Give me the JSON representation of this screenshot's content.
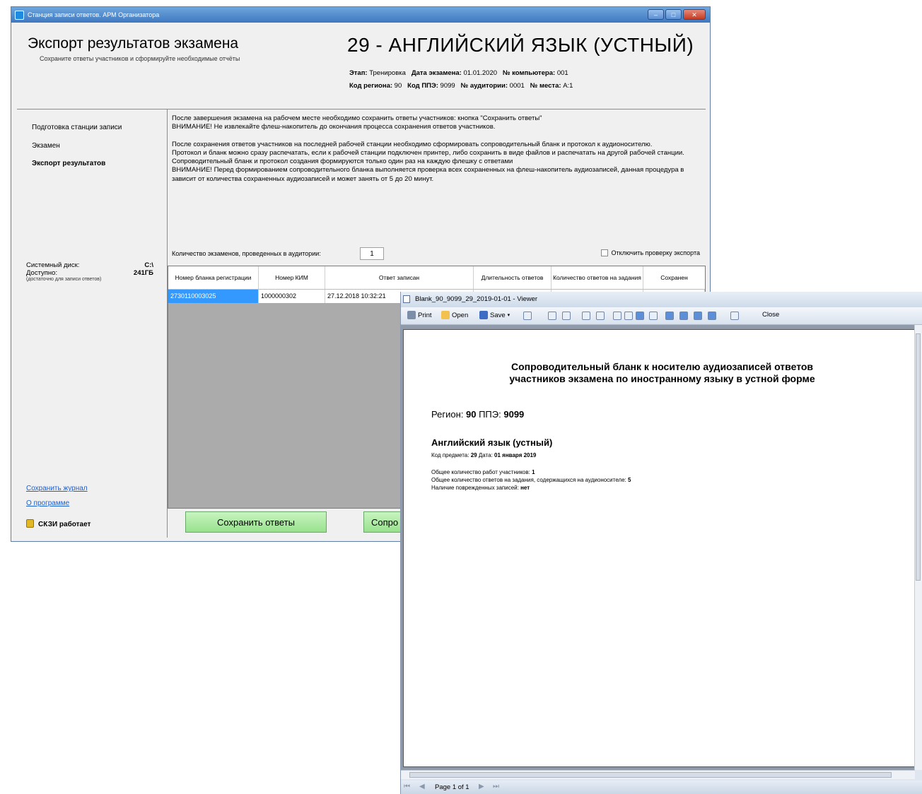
{
  "main_window": {
    "title": "Станция записи ответов. АРМ Организатора",
    "page_title": "Экспорт результатов экзамена",
    "page_subtitle": "Сохраните ответы участников и сформируйте необходимые отчёты",
    "subject_title": "29 - АНГЛИЙСКИЙ ЯЗЫК (УСТНЫЙ)",
    "info": {
      "stage_label": "Этап:",
      "stage_value": "Тренировка",
      "date_label": "Дата экзамена:",
      "date_value": "01.01.2020",
      "pc_label": "№ компьютера:",
      "pc_value": "001",
      "region_label": "Код региона:",
      "region_value": "90",
      "ppe_label": "Код ППЭ:",
      "ppe_value": "9099",
      "room_label": "№ аудитории:",
      "room_value": "0001",
      "seat_label": "№ места:",
      "seat_value": "А:1"
    },
    "nav": {
      "prep": "Подготовка станции записи",
      "exam": "Экзамен",
      "export": "Экспорт результатов"
    },
    "disk": {
      "system_label": "Системный диск:",
      "system_value": "C:\\",
      "free_label": "Доступно:",
      "free_value": "241ГБ",
      "note": "(достаточно для записи ответов)"
    },
    "links": {
      "save_log": "Сохранить журнал",
      "about": "О программе"
    },
    "skzi_status": "СКЗИ работает",
    "instructions": [
      "После завершения экзамена на рабочем месте необходимо сохранить ответы участников: кнопка \"Сохранить ответы\"\nВНИМАНИЕ! Не извлекайте флеш-накопитель до окончания процесса сохранения ответов участников.",
      "После сохранения ответов участников на последней рабочей станции необходимо сформировать сопроводительный бланк и протокол к аудионосителю.\nПротокол и бланк можно сразу распечатать, если к рабочей станции подключен принтер, либо сохранить в виде файлов и распечатать на другой рабочей станции. Сопроводительный бланк и протокол создания формируются только один раз на каждую флешку с ответами\nВНИМАНИЕ! Перед формированием сопроводительного бланка выполняется проверка всех сохраненных на флеш-накопитель аудиозаписей, данная процедура в зависит от количества сохраненных аудиозаписей и может занять от 5 до 20 минут."
    ],
    "count_label": "Количество экзаменов, проведенных в аудитории:",
    "count_value": "1",
    "disable_check_label": "Отключить проверку экспорта",
    "table": {
      "headers": [
        "Номер бланка регистрации",
        "Номер КИМ",
        "Ответ записан",
        "Длительность ответов",
        "Количество ответов на задания",
        "Сохранен"
      ],
      "row": [
        "2730110003025",
        "1000000302",
        "27.12.2018 10:32:21",
        "",
        "",
        ""
      ]
    },
    "buttons": {
      "save_answers": "Сохранить ответы",
      "accompany": "Сопро"
    }
  },
  "viewer": {
    "title": "Blank_90_9099_29_2019-01-01 - Viewer",
    "toolbar": {
      "print": "Print",
      "open": "Open",
      "save": "Save",
      "close": "Close"
    },
    "page_indicator": "Page 1 of 1",
    "document": {
      "title_line1": "Сопроводительный бланк к носителю аудиозаписей ответов",
      "title_line2": "участников экзамена по иностранному языку в устной форме",
      "region_label": "Регион:",
      "region_value": "90",
      "ppe_label": "ППЭ:",
      "ppe_value": "9099",
      "subject": "Английский язык (устный)",
      "code_label": "Код предмета:",
      "code_value": "29",
      "date_label": "Дата:",
      "date_value": "01 января 2019",
      "works_label": "Общее количество работ участников:",
      "works_value": "1",
      "answers_label": "Общее количество ответов на задания, содержащихся на аудионосителе:",
      "answers_value": "5",
      "damaged_label": "Наличие поврежденных записей:",
      "damaged_value": "нет"
    }
  }
}
